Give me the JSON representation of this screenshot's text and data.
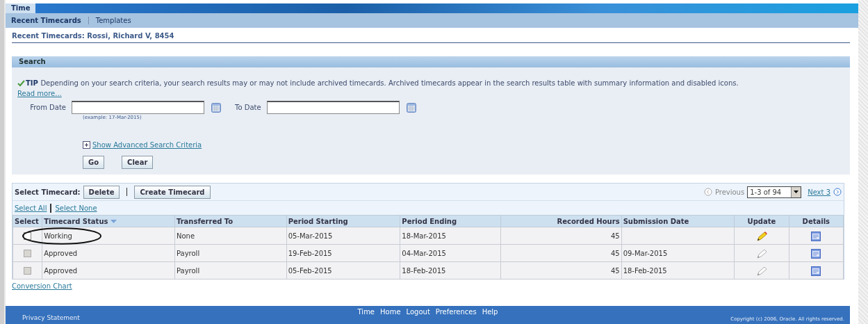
{
  "top_tab": {
    "label": "Time"
  },
  "subtabs": [
    {
      "label": "Recent Timecards",
      "selected": true
    },
    {
      "label": "Templates",
      "selected": false
    }
  ],
  "page_title": "Recent Timecards: Rossi, Richard V, 8454",
  "search": {
    "title": "Search",
    "tip_label": "TIP",
    "tip_text": "Depending on your search criteria, your search results may or may not include archived timecards. Archived timecards appear in the search results table with summary information and disabled icons.",
    "read_more": "Read more...",
    "from_label": "From Date",
    "to_label": "To Date",
    "example": "(example: 17-Mar-2015)",
    "advanced": "Show Advanced Search Criteria",
    "buttons": [
      "Go",
      "Clear"
    ]
  },
  "toolbar": {
    "label": "Select Timecard:",
    "buttons": [
      "Delete",
      "Create Timecard"
    ],
    "previous": "Previous",
    "range": "1-3 of 94",
    "next": "Next 3"
  },
  "select_links": [
    "Select All",
    "Select None"
  ],
  "columns": [
    "Select",
    "Timecard Status",
    "Transferred To",
    "Period Starting",
    "Period Ending",
    "Recorded Hours",
    "Submission Date",
    "Update",
    "Details"
  ],
  "rows": [
    {
      "status": "Working",
      "transferred_to": "None",
      "period_starting": "05-Mar-2015",
      "period_ending": "18-Mar-2015",
      "recorded_hours": "45",
      "submission_date": "",
      "checkbox_disabled": false,
      "update_enabled": true,
      "circled": true
    },
    {
      "status": "Approved",
      "transferred_to": "Payroll",
      "period_starting": "19-Feb-2015",
      "period_ending": "04-Mar-2015",
      "recorded_hours": "45",
      "submission_date": "09-Mar-2015",
      "checkbox_disabled": true,
      "update_enabled": false,
      "circled": false
    },
    {
      "status": "Approved",
      "transferred_to": "Payroll",
      "period_starting": "05-Feb-2015",
      "period_ending": "18-Feb-2015",
      "recorded_hours": "45",
      "submission_date": "18-Feb-2015",
      "checkbox_disabled": true,
      "update_enabled": false,
      "circled": false
    }
  ],
  "conversion_chart": "Conversion Chart",
  "footer": {
    "links": [
      "Time",
      "Home",
      "Logout",
      "Preferences",
      "Help"
    ],
    "privacy": "Privacy Statement",
    "copyright": "Copyright (c) 2006, Oracle. All rights reserved."
  }
}
